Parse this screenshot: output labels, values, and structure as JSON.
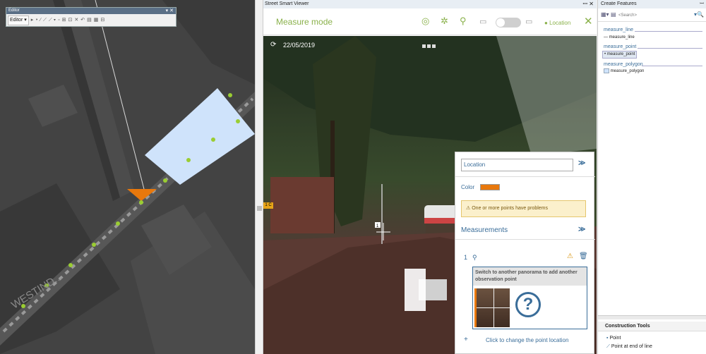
{
  "editor": {
    "title": "Editor",
    "title_controls": "▾ ✕",
    "menu_label": "Editor ▾",
    "tools": [
      "▸",
      "⁍",
      "∕",
      "⟋",
      "⟋ ▾",
      "▫",
      "⊞",
      "⊡",
      "✕",
      "↶",
      "▤",
      "▦",
      "⊟"
    ]
  },
  "map": {
    "street_label": "WESTIND..."
  },
  "ssv": {
    "window_title": "Street Smart Viewer",
    "window_controls": "ꟷ ✕",
    "mode_label": "Measure mode",
    "header_icons": [
      "target-icon",
      "pin-icon",
      "measure-point-icon"
    ],
    "location_label": "Location",
    "close_label": "✕",
    "date": "22/05/2019",
    "marker_label": "1 C",
    "panel": {
      "location_select": "Location",
      "color_label": "Color",
      "color_value": "#e8780c",
      "warning_text": "One or more points have problems",
      "measurements_label": "Measurements",
      "measurement_index": "1",
      "observation_text": "Switch to another panorama to add another observation point",
      "help_glyph": "?",
      "add_label": "+",
      "change_link": "Click to change the point location"
    }
  },
  "create_features": {
    "title": "Create Features",
    "title_controls": "ꟷ",
    "search_placeholder": "<Search>",
    "groups": [
      {
        "name": "measure_line",
        "item": "measure_line"
      },
      {
        "name": "measure_point",
        "item": "measure_point"
      },
      {
        "name": "measure_polygon",
        "item": "measure_polygon"
      }
    ],
    "construction_tools_label": "Construction Tools",
    "tools": [
      "Point",
      "Point at end of line"
    ]
  },
  "colors": {
    "accent_green": "#8ab14b",
    "link_blue": "#3a6d99",
    "map_feature": "#cfe3fb",
    "orange": "#e8780c"
  }
}
